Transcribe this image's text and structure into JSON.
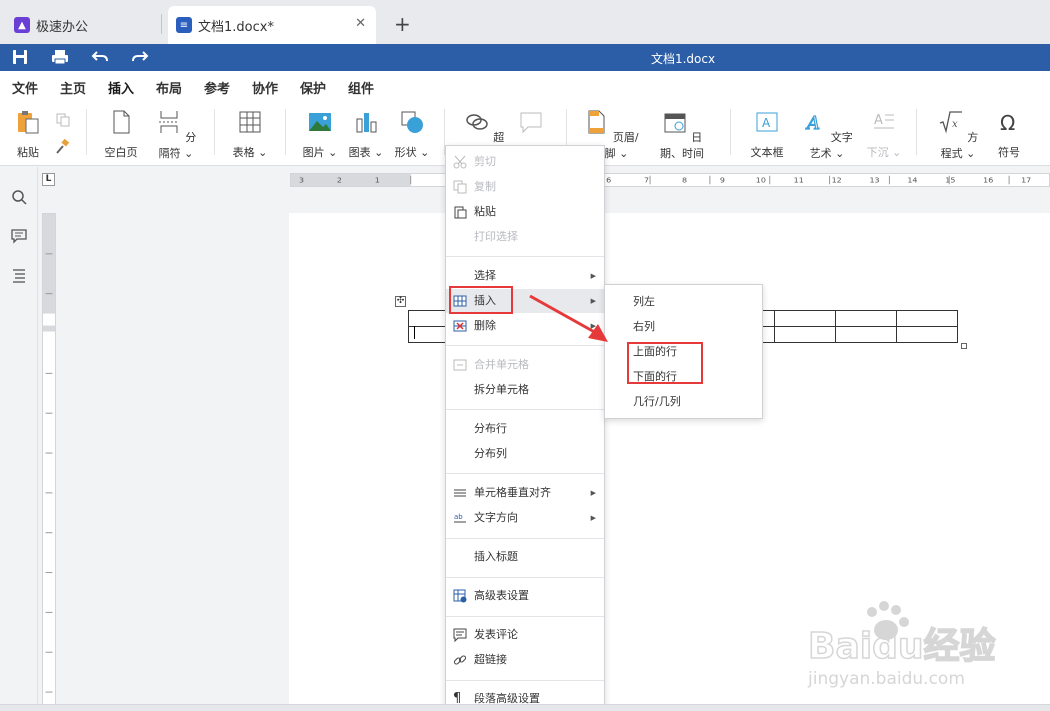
{
  "tabs": {
    "app_label": "极速办公",
    "doc_label": "文档1.docx*",
    "close_glyph": "✕",
    "add_glyph": "+"
  },
  "titlebar": {
    "title": "文档1.docx",
    "accent": "#2b5ea7"
  },
  "menubar": {
    "items": [
      "文件",
      "主页",
      "插入",
      "布局",
      "参考",
      "协作",
      "保护",
      "组件"
    ],
    "active": "插入"
  },
  "ribbon": {
    "paste": "粘贴",
    "blank_page": "空白页",
    "page_break": "分隔符",
    "table": "表格",
    "picture": "图片",
    "chart": "图表",
    "shape": "形状",
    "hyperlink": "超链接",
    "comment": "批注",
    "header_footer": "页眉/页脚",
    "datetime": "日期、时间",
    "textbox": "文本框",
    "textart": "文字艺术",
    "dropcap": "下沉",
    "equation": "方程式",
    "symbol": "符号"
  },
  "context_menu": {
    "cut": "剪切",
    "copy": "复制",
    "paste": "粘贴",
    "print_selection": "打印选择",
    "select": "选择",
    "insert": "插入",
    "delete": "删除",
    "merge_cells": "合并单元格",
    "split_cell": "拆分单元格",
    "distribute_rows": "分布行",
    "distribute_cols": "分布列",
    "cell_valign": "单元格垂直对齐",
    "text_direction": "文字方向",
    "insert_caption": "插入标题",
    "advanced_table": "高级表设置",
    "post_comment": "发表评论",
    "hyperlink": "超链接",
    "paragraph_advanced": "段落高级设置"
  },
  "submenu": {
    "col_left": "列左",
    "col_right": "右列",
    "row_above": "上面的行",
    "row_below": "下面的行",
    "rows_cols": "几行/几列"
  },
  "colors": {
    "annotation_red": "#e63a3a",
    "highlight_bg": "#e8e9ec"
  },
  "watermark": {
    "brand": "Baidu经验",
    "url": "jingyan.baidu.com"
  }
}
